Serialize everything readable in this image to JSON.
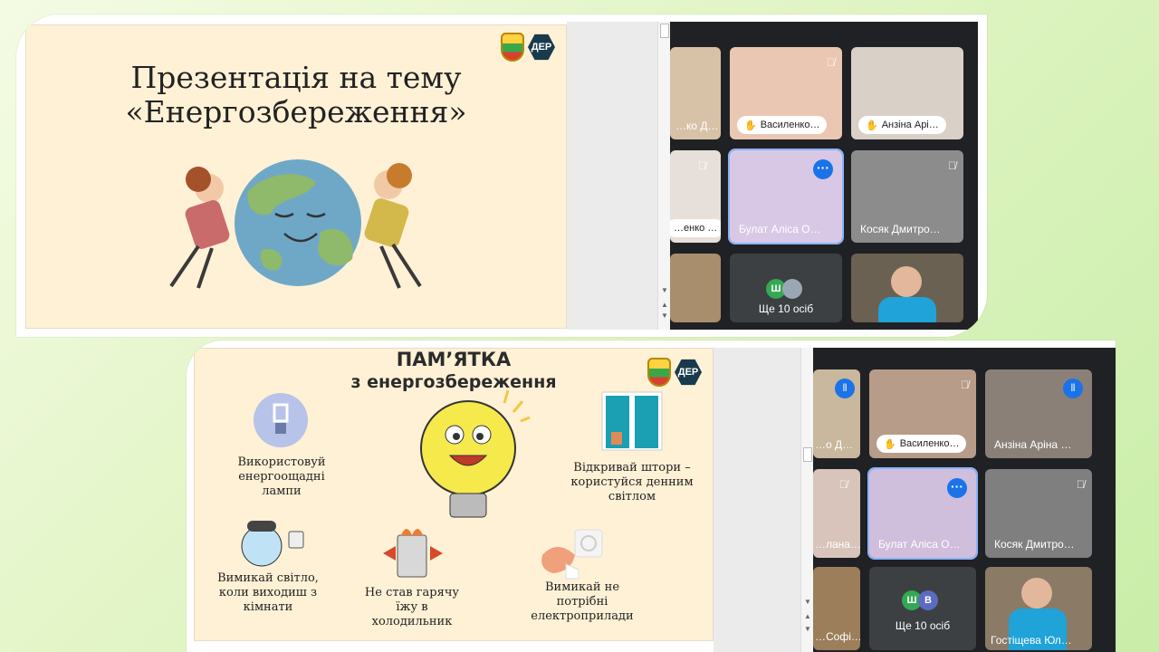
{
  "slide1": {
    "title_line1": "Презентація на тему",
    "title_line2": "«Енергозбереження»",
    "logo_text": "ДЕР"
  },
  "meet1": {
    "tiles": [
      {
        "name": "…ко Д…",
        "state": "video"
      },
      {
        "name": "Василенко…",
        "state": "hand"
      },
      {
        "name": "Анзіна Арі…",
        "state": "hand"
      },
      {
        "name": "…енко …",
        "state": "mic-off"
      },
      {
        "name": "Булат Аліса О…",
        "state": "active"
      },
      {
        "name": "Косяк Дмитро…",
        "state": "mic-off"
      },
      {
        "name": "",
        "state": "video"
      },
      {
        "more_label": "Ще 10 осіб",
        "avatars": [
          "Ш"
        ]
      },
      {
        "name": "",
        "state": "video"
      }
    ]
  },
  "slide2": {
    "title_line1": "ПАМ’ЯТКА",
    "title_line2": "з енергозбереження",
    "logo_text": "ДЕР",
    "tips": [
      "Використовуй енергоощадні лампи",
      "Відкривай штори – користуйся денним світлом",
      "Вимикай світло, коли виходиш з кімнати",
      "Не став гарячу їжу в холодильник",
      "Вимикай не потрібні електроприлади"
    ]
  },
  "meet2": {
    "tiles": [
      {
        "name": "…о Д…",
        "state": "speaking"
      },
      {
        "name": "Василенко…",
        "state": "hand"
      },
      {
        "name": "Анзіна Аріна …",
        "state": "speaking"
      },
      {
        "name": "…лана…",
        "state": "mic-off"
      },
      {
        "name": "Булат Аліса О…",
        "state": "active"
      },
      {
        "name": "Косяк Дмитро…",
        "state": "mic-off"
      },
      {
        "name": "…Софі…",
        "state": "video"
      },
      {
        "more_label": "Ще 10 осіб",
        "avatars": [
          "Ш",
          "В"
        ]
      },
      {
        "name": "Гостіщева Юл…",
        "state": "video"
      }
    ]
  },
  "colors": {
    "meet_bg": "#202124",
    "accent": "#1a73e8",
    "slide_bg": "#fff1d6"
  }
}
